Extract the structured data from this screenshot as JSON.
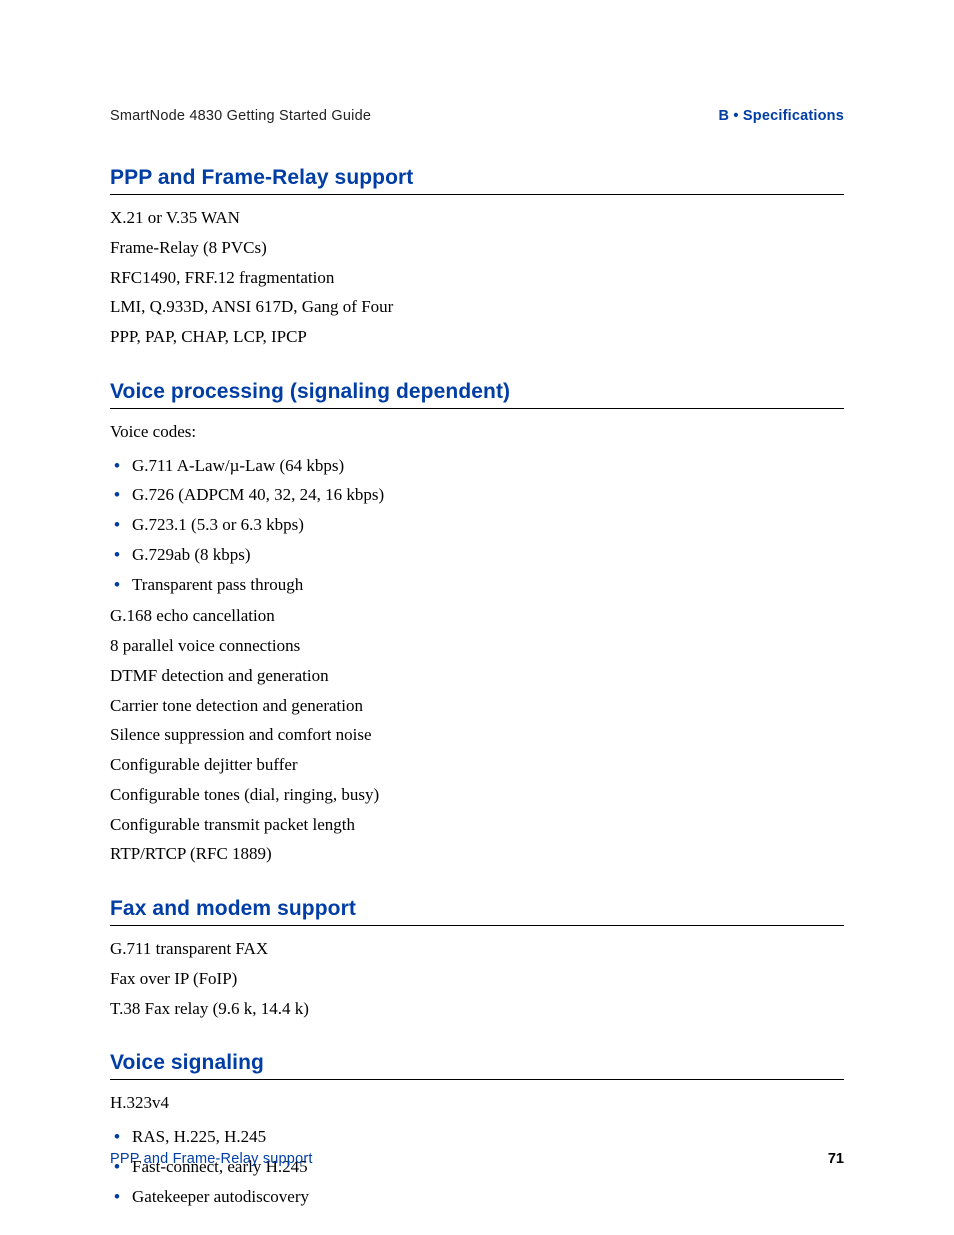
{
  "header": {
    "left": "SmartNode 4830 Getting Started Guide",
    "right": "B • Specifications"
  },
  "sections": {
    "ppp": {
      "title": "PPP and Frame-Relay support",
      "lines": [
        "X.21 or V.35 WAN",
        "Frame-Relay (8 PVCs)",
        "RFC1490, FRF.12 fragmentation",
        "LMI, Q.933D, ANSI 617D, Gang of Four",
        "PPP, PAP, CHAP, LCP, IPCP"
      ]
    },
    "voice_proc": {
      "title": "Voice processing (signaling dependent)",
      "intro": "Voice codes:",
      "bullets": [
        "G.711 A-Law/µ-Law (64 kbps)",
        "G.726 (ADPCM 40, 32, 24, 16 kbps)",
        "G.723.1 (5.3 or 6.3 kbps)",
        "G.729ab (8 kbps)",
        "Transparent pass through"
      ],
      "lines_after": [
        "G.168 echo cancellation",
        "8 parallel voice connections",
        "DTMF detection and generation",
        "Carrier tone detection and generation",
        "Silence suppression and comfort noise",
        "Configurable dejitter buffer",
        "Configurable tones (dial, ringing, busy)",
        "Configurable transmit packet length",
        "RTP/RTCP (RFC 1889)"
      ]
    },
    "fax": {
      "title": "Fax and modem support",
      "lines": [
        "G.711 transparent FAX",
        "Fax over IP (FoIP)",
        "T.38 Fax relay (9.6 k, 14.4 k)"
      ]
    },
    "voice_sig": {
      "title": "Voice signaling",
      "intro": "H.323v4",
      "bullets": [
        "RAS, H.225, H.245",
        "Fast-connect, early H.245",
        "Gatekeeper autodiscovery"
      ]
    }
  },
  "footer": {
    "left": "PPP and Frame-Relay support",
    "page": "71"
  }
}
